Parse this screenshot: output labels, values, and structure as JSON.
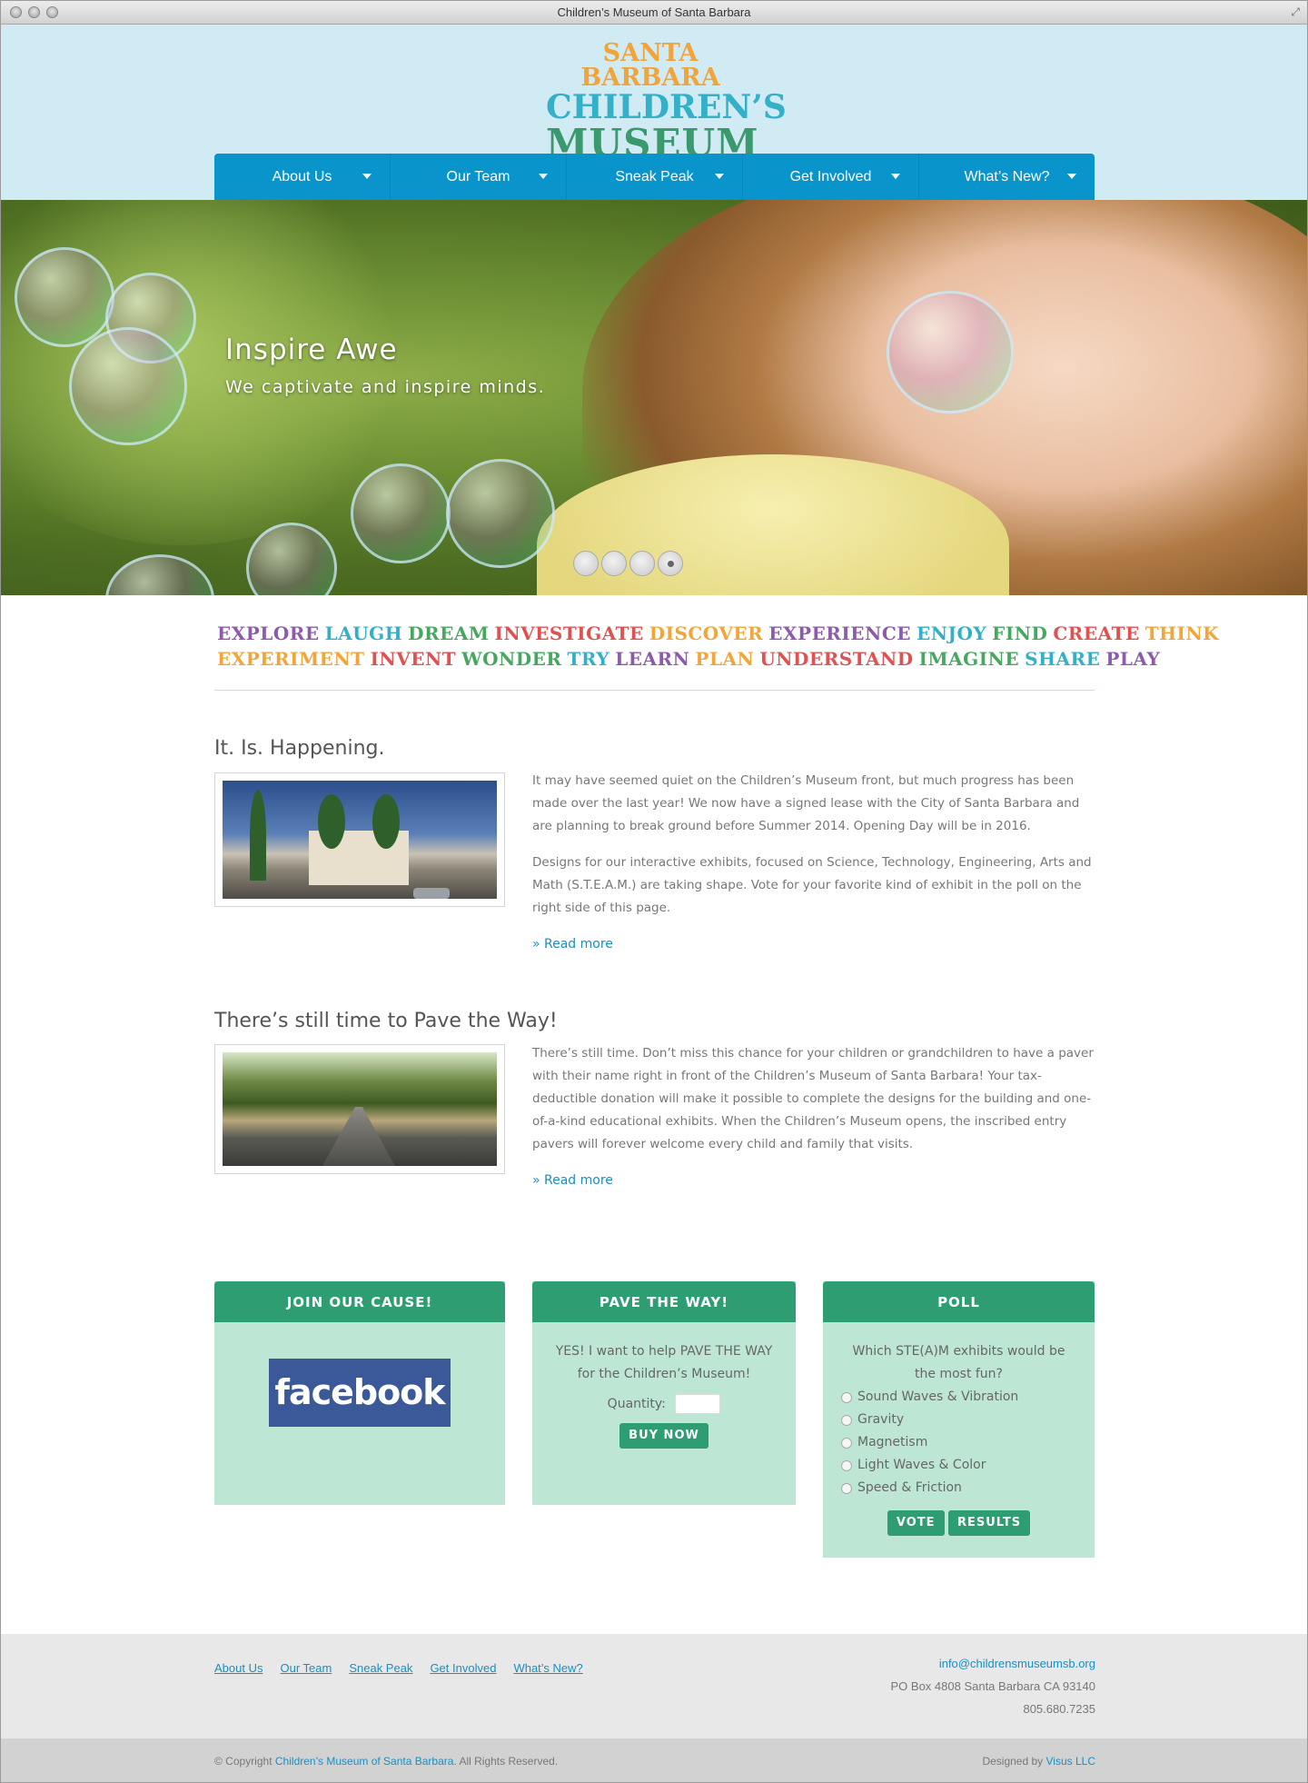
{
  "window": {
    "title": "Children’s Museum of Santa Barbara"
  },
  "logo": {
    "line1": "SANTA BARBARA",
    "line2": "CHILDREN’S",
    "line3": "MUSEUM"
  },
  "nav": {
    "items": [
      "About Us",
      "Our Team",
      "Sneak Peak",
      "Get Involved",
      "What’s New?"
    ]
  },
  "hero": {
    "heading": "Inspire Awe",
    "subheading": "We captivate and inspire minds.",
    "slides": 4,
    "active_slide": 4
  },
  "words": {
    "line1": [
      {
        "text": "EXPLORE",
        "color": "#8e5bab"
      },
      {
        "text": "LAUGH",
        "color": "#33b0c6"
      },
      {
        "text": "DREAM",
        "color": "#47a75f"
      },
      {
        "text": "INVESTIGATE",
        "color": "#e05252"
      },
      {
        "text": "DISCOVER",
        "color": "#f2a53a"
      },
      {
        "text": "EXPERIENCE",
        "color": "#8e5bab"
      },
      {
        "text": "ENJOY",
        "color": "#33b0c6"
      },
      {
        "text": "FIND",
        "color": "#47a75f"
      },
      {
        "text": "CREATE",
        "color": "#e05252"
      },
      {
        "text": "THINK",
        "color": "#f2a53a"
      }
    ],
    "line2": [
      {
        "text": "EXPERIMENT",
        "color": "#f2a53a"
      },
      {
        "text": "INVENT",
        "color": "#e05252"
      },
      {
        "text": "WONDER",
        "color": "#47a75f"
      },
      {
        "text": "TRY",
        "color": "#33b0c6"
      },
      {
        "text": "LEARN",
        "color": "#8e5bab"
      },
      {
        "text": "PLAN",
        "color": "#f2a53a"
      },
      {
        "text": "UNDERSTAND",
        "color": "#e05252"
      },
      {
        "text": "IMAGINE",
        "color": "#47a75f"
      },
      {
        "text": "SHARE",
        "color": "#33b0c6"
      },
      {
        "text": "PLAY",
        "color": "#8e5bab"
      }
    ]
  },
  "articles": [
    {
      "title": "It. Is. Happening.",
      "paragraphs": [
        "It may have seemed quiet on the Children’s Museum front, but much progress has been made over the last year! We now have a signed lease with the City of Santa Barbara and are planning to break ground before Summer 2014. Opening Day will be in 2016.",
        "Designs for our interactive exhibits, focused on Science, Technology, Engineering, Arts and Math (S.T.E.A.M.) are taking shape. Vote for your favorite kind of exhibit in the poll on the right side of this page."
      ],
      "read_more": "» Read more"
    },
    {
      "title": "There’s still time to Pave the Way!",
      "paragraphs": [
        "There’s still time. Don’t miss this chance for your children or grandchildren to have a paver with their name right in front of the Children’s Museum of Santa Barbara! Your tax-deductible donation will make it possible to complete the designs for the building and one-of-a-kind educational exhibits. When the Children’s Museum opens, the inscribed entry pavers will forever welcome every child and family that visits."
      ],
      "read_more": "» Read more"
    }
  ],
  "panels": {
    "join": {
      "title": "JOIN OUR CAUSE!",
      "facebook": "facebook"
    },
    "pave": {
      "title": "PAVE THE WAY!",
      "text": "YES! I want to help PAVE THE WAY for the Children’s Museum!",
      "quantity_label": "Quantity:",
      "quantity_value": "",
      "buy": "BUY NOW"
    },
    "poll": {
      "title": "POLL",
      "question": "Which STE(A)M exhibits would be the most fun?",
      "options": [
        "Sound Waves & Vibration",
        "Gravity",
        "Magnetism",
        "Light Waves & Color",
        "Speed & Friction"
      ],
      "vote": "VOTE",
      "results": "RESULTS"
    }
  },
  "footer": {
    "links": [
      "About Us",
      "Our Team",
      "Sneak Peak",
      "Get Involved",
      "What’s New?"
    ],
    "email": "info@childrensmuseumsb.org",
    "address": "PO Box 4808 Santa Barbara CA 93140",
    "phone": "805.680.7235",
    "copyright_prefix": "© Copyright",
    "copyright_link": "Children’s Museum of Santa Barbara",
    "copyright_suffix": ". All Rights Reserved.",
    "designed_prefix": "Designed by",
    "designed_link": "Visus LLC"
  },
  "colors": {
    "nav": "#0995cb",
    "panel_header": "#2e9e72",
    "panel_body": "#bde6d5",
    "link": "#1a8fc0",
    "header_bg": "#d1ebf5"
  }
}
